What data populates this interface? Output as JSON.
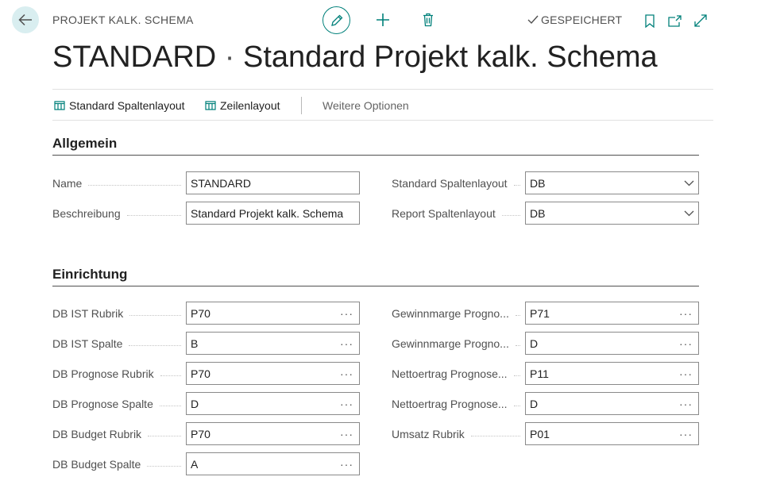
{
  "header": {
    "caption": "PROJEKT KALK. SCHEMA",
    "saved_status": "GESPEICHERT",
    "icons": {
      "back": "arrow-left-icon",
      "edit": "pencil-icon",
      "new": "plus-icon",
      "delete": "trash-icon",
      "bookmark": "bookmark-icon",
      "open_new": "open-in-new-window-icon",
      "expand": "expand-icon",
      "saved": "checkmark-icon"
    }
  },
  "title": {
    "code": "STANDARD",
    "separator": "·",
    "description": "Standard Projekt kalk. Schema"
  },
  "actions": {
    "standard_column_layout": "Standard Spaltenlayout",
    "row_layout": "Zeilenlayout",
    "more_options": "Weitere Optionen"
  },
  "general": {
    "title": "Allgemein",
    "left": [
      {
        "label": "Name",
        "value": "STANDARD"
      },
      {
        "label": "Beschreibung",
        "value": "Standard Projekt kalk. Schema"
      }
    ],
    "right": [
      {
        "label": "Standard Spaltenlayout",
        "value": "DB"
      },
      {
        "label": "Report Spaltenlayout",
        "value": "DB"
      }
    ]
  },
  "setup": {
    "title": "Einrichtung",
    "left": [
      {
        "label": "DB IST Rubrik",
        "value": "P70"
      },
      {
        "label": "DB IST Spalte",
        "value": "B"
      },
      {
        "label": "DB Prognose Rubrik",
        "value": "P70"
      },
      {
        "label": "DB Prognose Spalte",
        "value": "D"
      },
      {
        "label": "DB Budget Rubrik",
        "value": "P70"
      },
      {
        "label": "DB Budget Spalte",
        "value": "A"
      }
    ],
    "right": [
      {
        "label": "Gewinnmarge Progno...",
        "value": "P71"
      },
      {
        "label": "Gewinnmarge Progno...",
        "value": "D"
      },
      {
        "label": "Nettoertrag Prognose...",
        "value": "P11"
      },
      {
        "label": "Nettoertrag Prognose...",
        "value": "D"
      },
      {
        "label": "Umsatz Rubrik",
        "value": "P01"
      }
    ],
    "lookup_glyph": "···"
  },
  "colors": {
    "accent": "#00807a",
    "back_bg": "#d9eef0"
  }
}
